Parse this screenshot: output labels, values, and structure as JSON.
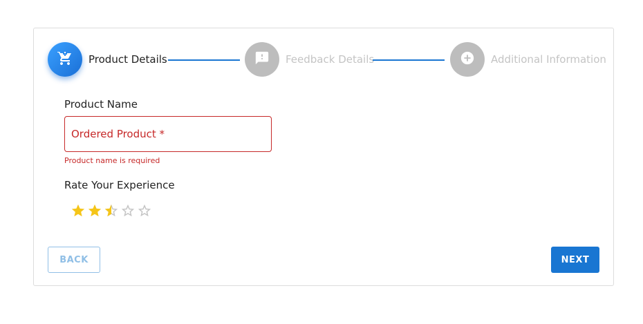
{
  "stepper": {
    "steps": [
      {
        "label": "Product Details",
        "icon": "shopping-cart-icon",
        "state": "active"
      },
      {
        "label": "Feedback Details",
        "icon": "feedback-icon",
        "state": "inactive"
      },
      {
        "label": "Additional Information",
        "icon": "add-circle-icon",
        "state": "inactive"
      }
    ]
  },
  "form": {
    "product_name_label": "Product Name",
    "product_name_placeholder": "Ordered Product *",
    "product_name_value": "",
    "product_name_error": "Product name is required",
    "rating_label": "Rate Your Experience",
    "rating_value": 2.5,
    "rating_max": 5
  },
  "buttons": {
    "back_label": "BACK",
    "next_label": "NEXT"
  },
  "colors": {
    "primary": "#1976d2",
    "error": "#c62828",
    "star_filled": "#f5c518",
    "star_empty": "#c4c4c4",
    "inactive_step": "#bdbdbd"
  }
}
